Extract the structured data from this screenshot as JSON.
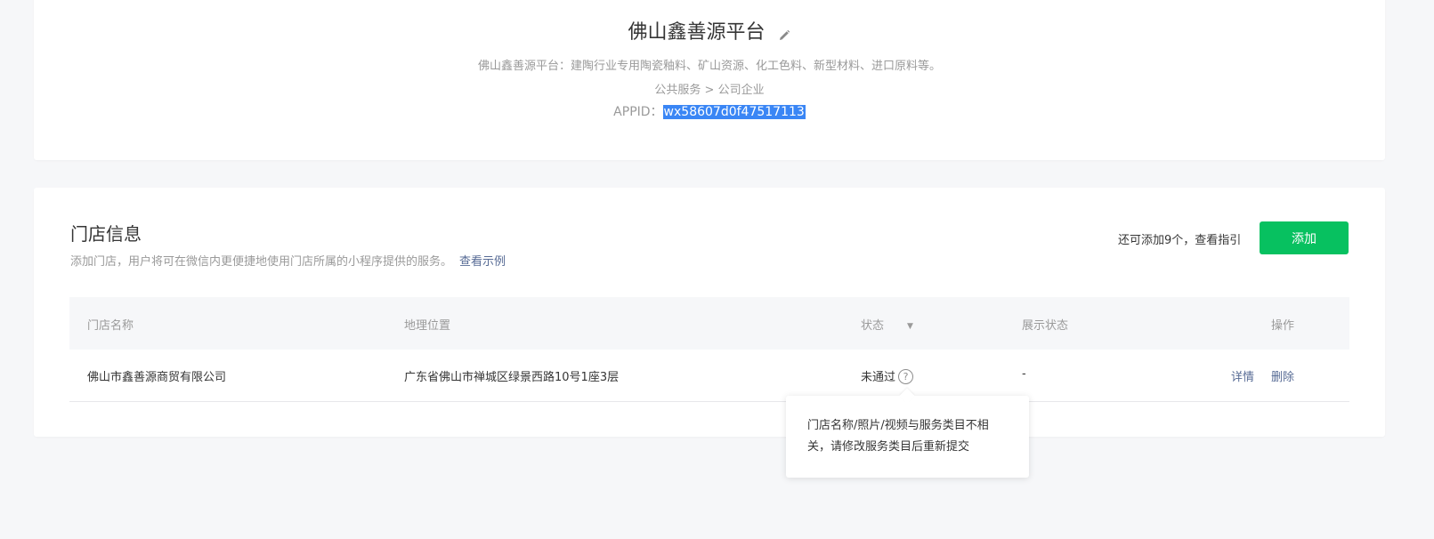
{
  "app": {
    "name": "佛山鑫善源平台",
    "description": "佛山鑫善源平台：建陶行业专用陶瓷釉料、矿山资源、化工色料、新型材料、进口原料等。",
    "category": "公共服务 > 公司企业",
    "appid_label": "APPID：",
    "appid_value": "wx58607d0f47517113"
  },
  "store_section": {
    "title": "门店信息",
    "description": "添加门店，用户将可在微信内更便捷地使用门店所属的小程序提供的服务。",
    "example_link": "查看示例",
    "remaining_text": "还可添加9个，查看指引",
    "add_button": "添加",
    "columns": [
      "门店名称",
      "地理位置",
      "状态",
      "展示状态",
      "操作"
    ],
    "rows": [
      {
        "name": "佛山市鑫善源商贸有限公司",
        "location": "广东省佛山市禅城区绿景西路10号1座3层",
        "status": "未通过",
        "display_status": "-",
        "actions": [
          "详情",
          "删除"
        ]
      }
    ],
    "tooltip": "门店名称/照片/视频与服务类目不相关，请修改服务类目后重新提交"
  },
  "icons": {
    "edit": "pencil-icon",
    "help": "question-circle-icon",
    "sort": "caret-down-icon"
  },
  "colors": {
    "primary": "#07c160",
    "link": "#576b95",
    "selection": "#3a86f5"
  }
}
